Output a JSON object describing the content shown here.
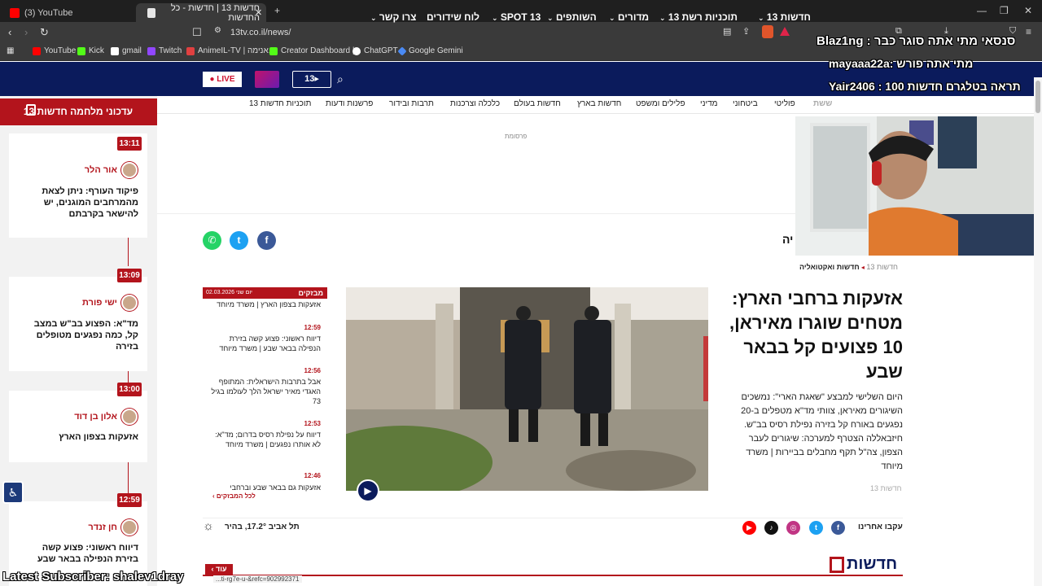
{
  "browser": {
    "tabs": [
      {
        "label": "(3) YouTube"
      },
      {
        "label": "חדשות 13 | חדשות - כל החדשות"
      }
    ],
    "url": "13tv.co.il/news/",
    "bookmarks": [
      {
        "label": "YouTube",
        "color": "#ff0000"
      },
      {
        "label": "Kick",
        "color": "#53fc18"
      },
      {
        "label": "gmail",
        "color": "#ffffff"
      },
      {
        "label": "Twitch",
        "color": "#9146ff"
      },
      {
        "label": "AnimeIL-TV | אנימה...",
        "color": "#e04040"
      },
      {
        "label": "Creator Dashboard |...",
        "color": "#53fc18"
      },
      {
        "label": "ChatGPT",
        "color": "#ffffff"
      },
      {
        "label": "Google Gemini",
        "color": "#4a8af4"
      }
    ],
    "status_url": "...ti-rg7e-u-&refc=902992371"
  },
  "site": {
    "live_label": "LIVE",
    "main_nav": [
      {
        "label": "חדשות 13"
      },
      {
        "label": "תוכניות רשת 13"
      },
      {
        "label": "מדורים"
      },
      {
        "label": "השותפים"
      },
      {
        "label": "SPOT 13"
      },
      {
        "label": "לוח שידורים"
      },
      {
        "label": "צרו קשר"
      }
    ],
    "sub_nav": [
      "פוליטי",
      "ביטחוני",
      "מדיני",
      "פלילים ומשפט",
      "חדשות בארץ",
      "חדשות בעולם",
      "כלכלה וצרכנות",
      "תרבות ובידור",
      "פרשנות ודעות",
      "תוכניות חדשות 13"
    ],
    "sub_nav_highlight": "ששת",
    "ad_label": "פרסומת",
    "breadcrumb": [
      "חדשות 13",
      "חדשות ואקטואליה"
    ],
    "headline": "אזעקות ברחבי הארץ: מטחים שוגרו מאיראן, 10 פצועים קל בבאר שבע",
    "summary": "היום השלישי למבצע \"שאגת הארי\": נמשכים השיגורים מאיראן, צוותי מד\"א מטפלים ב-20 נפגעים באורח קל בזירה נפילת רסיס בב\"ש. חיזבאללה הצטרף למערכה: שיגורים לעבר הצפון, צה\"ל תקף מחבלים בביירות | משרד מיוחד",
    "summary_source": "חדשות 13",
    "flash": {
      "label": "מבזקים",
      "date": "יום שני 02.03.2026",
      "items": [
        {
          "time": "",
          "text": "אזעקות בצפון הארץ | משרד מיוחד"
        },
        {
          "time": "12:59",
          "text": "דיווח ראשוני: פצוע קשה בזירת הנפילה בבאר שבע | משרד מיוחד"
        },
        {
          "time": "12:56",
          "text": "אבל בתרבות הישראלית: המתופף האגדי מאיר ישראל הלך לעולמו בגיל 73"
        },
        {
          "time": "12:53",
          "text": "דיווח על נפילת רסיס בדרום; מד\"א: לא אותרו נפגעים | משרד מיוחד"
        },
        {
          "time": "12:46",
          "text": "אזעקות גם בבאר שבע וברחבי"
        }
      ],
      "more": "לכל המבזקים"
    },
    "follow_label": "עקבו אחרינו",
    "weather": "תל אביב 17.2°, בהיר",
    "section_title": "חדשות",
    "section_more": "עוד"
  },
  "sidebar": {
    "title": "עדכוני מלחמה חדשות 13",
    "items": [
      {
        "time": "13:11",
        "author": "אור הלר",
        "text": "פיקוד העורף: ניתן לצאת מהמרחבים המוגנים, יש להישאר בקרבתם"
      },
      {
        "time": "13:09",
        "author": "ישי פורת",
        "text": "מד\"א: הפצוע בב\"ש במצב קל, כמה נפגעים מטופלים בזירה"
      },
      {
        "time": "13:00",
        "author": "אלון בן דוד",
        "text": "אזעקות בצפון הארץ"
      },
      {
        "time": "12:59",
        "author": "חן זנדר",
        "text": "דיווח ראשוני: פצוע קשה בזירת הנפילה בבאר שבע"
      }
    ]
  },
  "stream": {
    "chat1": "סנסאי מתי אתה סוגר כבר : Blaz1ng",
    "chat2": "מתי אתה פורש :mayaaa22a",
    "chat3": "תראה בטלגרם חדשות 100 : Yair2406",
    "subscriber": "Latest Subscriber: shalev1dray"
  }
}
